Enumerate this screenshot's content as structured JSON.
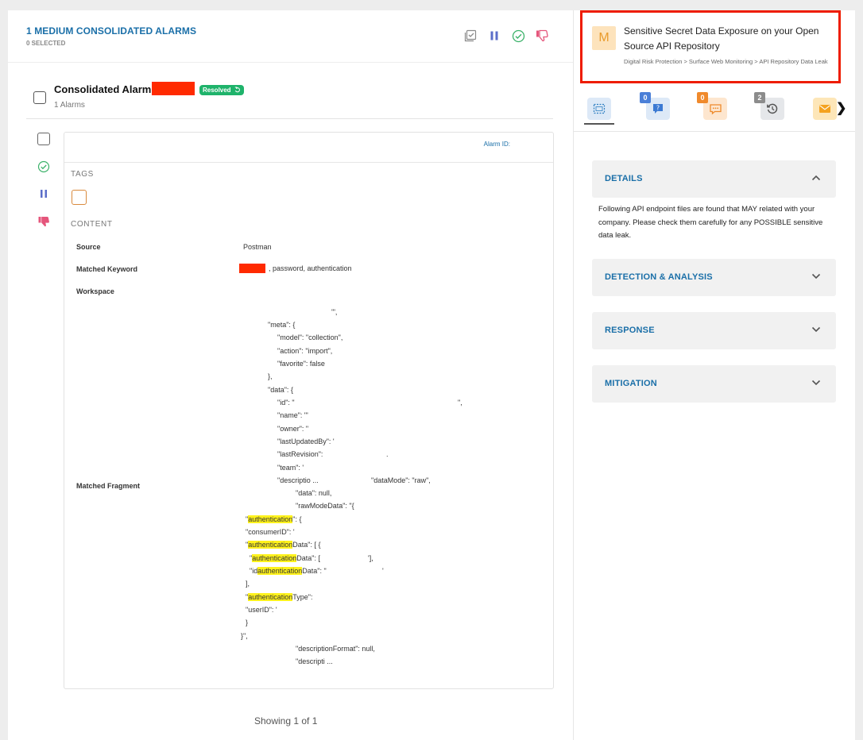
{
  "header": {
    "title": "1 MEDIUM CONSOLIDATED ALARMS",
    "selected": "0 SELECTED",
    "action_icons": [
      "select-all-icon",
      "pause-icon",
      "check-circle-icon",
      "thumbs-down-icon"
    ]
  },
  "consolidated": {
    "title": "Consolidated Alarm",
    "status": "Resolved",
    "count": "1 Alarms"
  },
  "card": {
    "alarm_id_label": "Alarm ID:",
    "tags_label": "TAGS",
    "content_label": "CONTENT",
    "source_label": "Source",
    "source_value": "Postman",
    "keyword_label": "Matched Keyword",
    "keyword_value": ", password, authentication",
    "workspace_label": "Workspace",
    "fragment_label": "Matched Fragment",
    "fragment_lines": [
      "'\",",
      "\"meta\": {",
      "\"model\": \"collection\",",
      "\"action\": \"import\",",
      "\"favorite\": false",
      "},",
      "\"data\": {",
      "\"id\": \"",
      "\",",
      "\"name\": \"'",
      "\"owner\": \"",
      "\"lastUpdatedBy\": '",
      "\"lastRevision\":",
      ".",
      "\"team\": '",
      "\"descriptio ...",
      "\"dataMode\": \"raw\",",
      "\"data\": null,",
      "\"rawModeData\": \"{",
      "\"",
      "authentication",
      "\": {",
      "\"consumerID\": '",
      "\"",
      "authentication",
      "Data\": [ {",
      "\"",
      "authentication",
      "Data\": [",
      "'],",
      "\"id",
      "authentication",
      "Data\": \"",
      "'",
      "],",
      "\"",
      "authentication",
      "Type\":",
      "\"userID\": '",
      "}",
      "}\",",
      "\"descriptionFormat\": null,",
      "\"descripti ..."
    ]
  },
  "footer": {
    "showing": "Showing 1 of 1"
  },
  "alarm": {
    "severity": "M",
    "title": "Sensitive Secret Data Exposure on your Open Source API Repository",
    "path": "Digital Risk Protection > Surface Web Monitoring > API Repository Data Leak"
  },
  "tabs": [
    {
      "name": "details",
      "icon": "details-frame-icon",
      "badge": ""
    },
    {
      "name": "questions",
      "icon": "question-icon",
      "badge": "0"
    },
    {
      "name": "comments",
      "icon": "comment-icon",
      "badge": "0"
    },
    {
      "name": "history",
      "icon": "history-icon",
      "badge": "2"
    },
    {
      "name": "mail",
      "icon": "mail-icon",
      "badge": ""
    }
  ],
  "accordion": {
    "details_title": "DETAILS",
    "details_text": "Following API endpoint files are found that MAY related with your company. Please check them carefully for any POSSIBLE sensitive data leak.",
    "detection_title": "DETECTION & ANALYSIS",
    "response_title": "RESPONSE",
    "mitigation_title": "MITIGATION"
  },
  "colors": {
    "primary_blue": "#1a6fa8",
    "resolved_green": "#1fb36b",
    "redaction_red": "#ff2a00",
    "highlight_yellow": "#fff21c",
    "severity_orange": "#e99b2c"
  }
}
